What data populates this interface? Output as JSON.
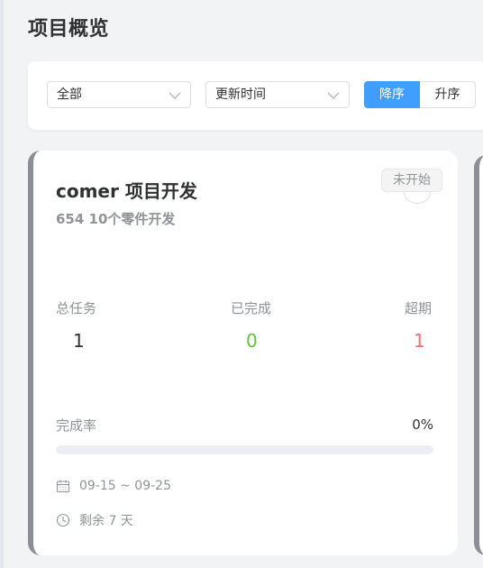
{
  "page": {
    "title": "项目概览"
  },
  "filters": {
    "status_select": {
      "value": "全部"
    },
    "sort_select": {
      "value": "更新时间"
    },
    "order": {
      "desc_label": "降序",
      "asc_label": "升序",
      "selected": "desc"
    }
  },
  "colors": {
    "accent": "#409eff",
    "done": "#67c23a",
    "overdue": "#f56c6c",
    "card_border": "#8c8f96"
  },
  "project_card": {
    "title": "comer 项目开发",
    "subtitle": "654 10个零件开发",
    "status": "未开始",
    "stats": {
      "total_label": "总任务",
      "total_value": "1",
      "done_label": "已完成",
      "done_value": "0",
      "overdue_label": "超期",
      "overdue_value": "1"
    },
    "completion": {
      "label": "完成率",
      "value_text": "0%",
      "value": 0
    },
    "date_range": "09-15 ~ 09-25",
    "remaining": "剩余 7 天",
    "icons": {
      "date": "calendar-icon",
      "remaining": "clock-icon"
    }
  }
}
